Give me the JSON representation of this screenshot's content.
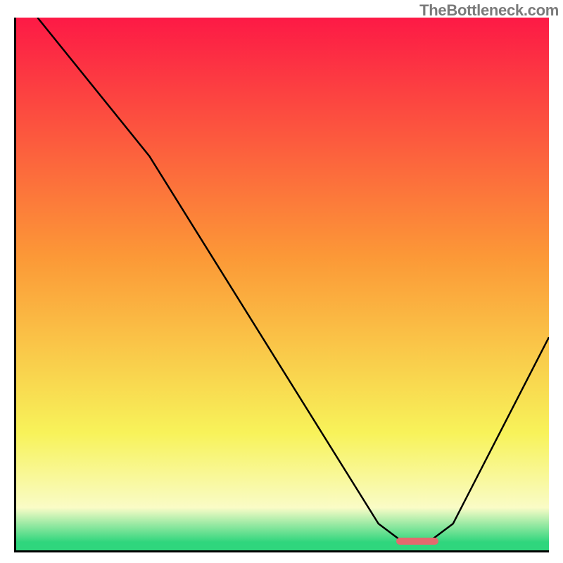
{
  "watermark": "TheBottleneck.com",
  "colors": {
    "top": "#fd1a46",
    "mid_upper": "#fc9937",
    "mid_lower": "#f8f35a",
    "pale": "#fafcc7",
    "green": "#2fd67d",
    "marker": "#e46a6e"
  },
  "chart_data": {
    "type": "line",
    "title": "",
    "xlabel": "",
    "ylabel": "",
    "xlim": [
      0,
      100
    ],
    "ylim": [
      0,
      100
    ],
    "curve": [
      {
        "x": 4,
        "y": 100
      },
      {
        "x": 25,
        "y": 74
      },
      {
        "x": 68,
        "y": 5
      },
      {
        "x": 72,
        "y": 2
      },
      {
        "x": 78,
        "y": 2
      },
      {
        "x": 82,
        "y": 5
      },
      {
        "x": 100,
        "y": 40
      }
    ],
    "optimum_range": {
      "x0": 71,
      "x1": 79,
      "y": 2
    },
    "gradient_stops": [
      {
        "pos": 0.0,
        "key": "top"
      },
      {
        "pos": 0.45,
        "key": "mid_upper"
      },
      {
        "pos": 0.78,
        "key": "mid_lower"
      },
      {
        "pos": 0.92,
        "key": "pale"
      },
      {
        "pos": 0.985,
        "key": "green"
      },
      {
        "pos": 1.0,
        "key": "green"
      }
    ]
  }
}
